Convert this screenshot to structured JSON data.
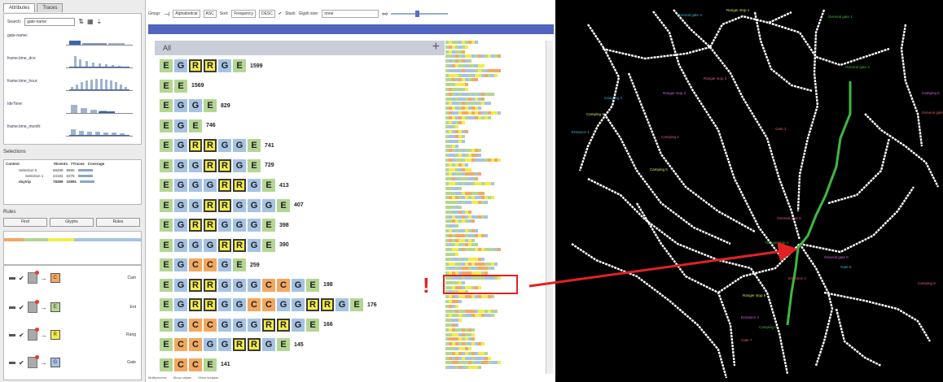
{
  "left_panel": {
    "tabs": [
      "Attributes",
      "Traces"
    ],
    "search": {
      "label": "Search:",
      "value": "gate-name"
    },
    "attributes": [
      "gate-name:",
      "frame.time_dcv:",
      "frame.time_hour:",
      "IdeTone:",
      "frame.time_month:"
    ],
    "selections_title": "Selections",
    "selections_headers": [
      "Context",
      "#Events",
      "#Traces",
      "Coverage"
    ],
    "selections_rows": [
      [
        "Selection 0",
        "88499",
        "9880"
      ],
      [
        "Selection 1",
        "34192",
        "6375"
      ],
      [
        "daytrip",
        "78389",
        "10991"
      ]
    ],
    "rules_title": "Rules",
    "rules_buttons": [
      "Find",
      "Glyphs",
      "Rules"
    ],
    "rules": [
      {
        "target": "C",
        "label": "Cam",
        "color": "#f3a860"
      },
      {
        "target": "E",
        "label": "Ent",
        "color": "#b4d693"
      },
      {
        "target": "R",
        "label": "Rang",
        "color": "#f3ec47"
      },
      {
        "target": "G",
        "label": "Gate",
        "color": "#a6c3e3"
      }
    ]
  },
  "toolbar": {
    "group_label": "Group:",
    "group_value": "Alphabetical",
    "order_value": "ASC",
    "sort_label": "Sort:",
    "sort_value": "Frequency",
    "dir_value": "DESC",
    "stack_label": "Stack",
    "glyph_size_label": "Glyph size:",
    "glyph_size_value": "none"
  },
  "main": {
    "all_label": "All",
    "plus": "+",
    "exclamation": "!",
    "patterns": [
      {
        "seq": [
          "E",
          "G",
          "R",
          "R",
          "G",
          "E"
        ],
        "count": "1599"
      },
      {
        "seq": [
          "E",
          "E"
        ],
        "count": "1569"
      },
      {
        "seq": [
          "E",
          "G",
          "G",
          "E"
        ],
        "count": "829"
      },
      {
        "seq": [
          "E",
          "G",
          "E"
        ],
        "count": "746"
      },
      {
        "seq": [
          "E",
          "G",
          "R",
          "R",
          "G",
          "G",
          "E"
        ],
        "count": "741"
      },
      {
        "seq": [
          "E",
          "G",
          "G",
          "R",
          "R",
          "G",
          "E"
        ],
        "count": "729"
      },
      {
        "seq": [
          "E",
          "G",
          "G",
          "G",
          "R",
          "R",
          "G",
          "E"
        ],
        "count": "413"
      },
      {
        "seq": [
          "E",
          "G",
          "G",
          "R",
          "R",
          "G",
          "G",
          "G",
          "E"
        ],
        "count": "407"
      },
      {
        "seq": [
          "E",
          "G",
          "R",
          "R",
          "G",
          "G",
          "G",
          "E"
        ],
        "count": "398"
      },
      {
        "seq": [
          "E",
          "G",
          "G",
          "G",
          "R",
          "R",
          "G",
          "E"
        ],
        "count": "390"
      },
      {
        "seq": [
          "E",
          "G",
          "C",
          "C",
          "G",
          "E"
        ],
        "count": "259"
      },
      {
        "seq": [
          "E",
          "G",
          "R",
          "R",
          "G",
          "G",
          "G",
          "C",
          "C",
          "G",
          "E"
        ],
        "count": "198"
      },
      {
        "seq": [
          "E",
          "G",
          "R",
          "R",
          "G",
          "G",
          "C",
          "C",
          "G",
          "G",
          "R",
          "R",
          "G",
          "E"
        ],
        "count": "176"
      },
      {
        "seq": [
          "E",
          "G",
          "C",
          "C",
          "G",
          "G",
          "G",
          "R",
          "R",
          "G",
          "E"
        ],
        "count": "166"
      },
      {
        "seq": [
          "E",
          "C",
          "C",
          "G",
          "G",
          "R",
          "R",
          "G",
          "E"
        ],
        "count": "145"
      },
      {
        "seq": [
          "E",
          "C",
          "C",
          "E"
        ],
        "count": "141"
      }
    ],
    "footer": [
      "Multiprocess",
      "Show values",
      "Show surpass"
    ]
  },
  "colors": {
    "E": "#b4d693",
    "G": "#a6c3e3",
    "R": "#f3ec47",
    "C": "#f3a860",
    "highlight": "#e22222",
    "road": "#ffffff",
    "route": "#3fb83f"
  },
  "map_labels": [
    "General gate 3",
    "Ranger stop 1",
    "Ranger stop 3",
    "General gate 1",
    "Ranger stop 2",
    "General gate 4",
    "Camping 3",
    "Camping 1",
    "Camping 2",
    "General gate 2",
    "Camping 6",
    "Gate 2",
    "Entrance 1",
    "Camping 5",
    "General gate 6",
    "Ranger stop 4",
    "General gate 5",
    "Entrance 4",
    "Gate 5",
    "Ranger stop 6",
    "Camping 8",
    "Camping 0",
    "Entrance 3",
    "Gate 7"
  ]
}
